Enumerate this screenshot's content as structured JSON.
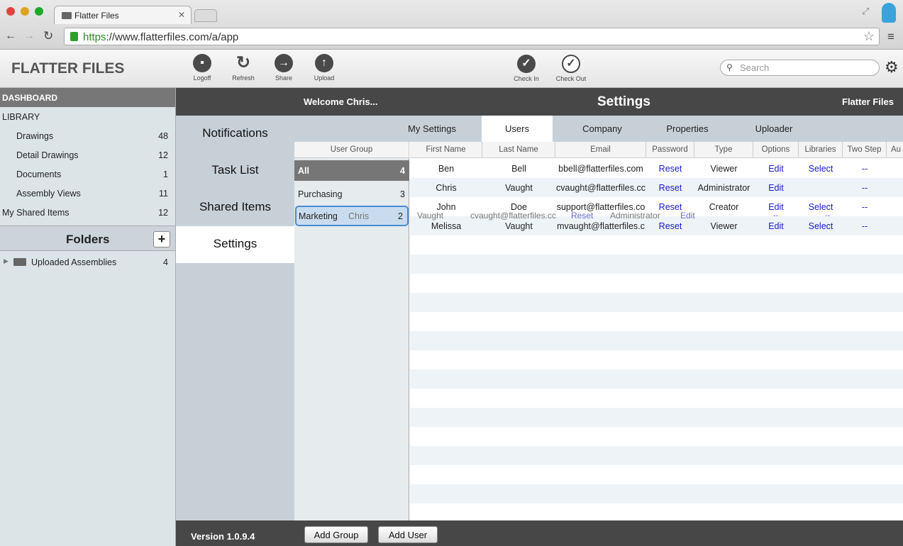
{
  "browser": {
    "tab_title": "Flatter Files",
    "url_scheme": "https",
    "url_rest": "://www.flatterfiles.com/a/app"
  },
  "app": {
    "logo": "FLATTER FILES",
    "toolbar": [
      "Logoff",
      "Refresh",
      "Share",
      "Upload",
      "Check In",
      "Check Out"
    ],
    "search_placeholder": "Search"
  },
  "sidebar": {
    "dashboard": "DASHBOARD",
    "library": "LIBRARY",
    "items": [
      {
        "label": "Drawings",
        "count": "48"
      },
      {
        "label": "Detail Drawings",
        "count": "12"
      },
      {
        "label": "Documents",
        "count": "1"
      },
      {
        "label": "Assembly Views",
        "count": "11"
      }
    ],
    "shared": {
      "label": "My Shared Items",
      "count": "12"
    },
    "folders_title": "Folders",
    "add_label": "+",
    "folder": {
      "label": "Uploaded Assemblies",
      "count": "4"
    }
  },
  "header": {
    "welcome": "Welcome Chris...",
    "title": "Settings",
    "brand": "Flatter Files"
  },
  "nav": [
    "Notifications",
    "Task List",
    "Shared Items",
    "Settings"
  ],
  "tabs": [
    "My Settings",
    "Users",
    "Company",
    "Properties",
    "Uploader"
  ],
  "groups": {
    "header": "User Group",
    "rows": [
      {
        "name": "All",
        "count": "4"
      },
      {
        "name": "Purchasing",
        "count": "3"
      },
      {
        "name": "Marketing",
        "count": "2"
      }
    ],
    "drag_ghost": "Chris"
  },
  "columns": [
    "First Name",
    "Last Name",
    "Email",
    "Password",
    "Type",
    "Options",
    "Libraries",
    "Two Step",
    "Au"
  ],
  "users": [
    {
      "first": "Ben",
      "last": "Bell",
      "email": "bbell@flatterfiles.com",
      "password": "Reset",
      "type": "Viewer",
      "options": "Edit",
      "libraries": "Select",
      "two_step": "--"
    },
    {
      "first": "Chris",
      "last": "Vaught",
      "email": "cvaught@flatterfiles.cc",
      "password": "Reset",
      "type": "Administrator",
      "options": "Edit",
      "libraries": "",
      "two_step": "--"
    },
    {
      "first": "John",
      "last": "Doe",
      "email": "support@flatterfiles.co",
      "password": "Reset",
      "type": "Creator",
      "options": "Edit",
      "libraries": "Select",
      "two_step": "--"
    },
    {
      "first": "Melissa",
      "last": "Vaught",
      "email": "mvaught@flatterfiles.c",
      "password": "Reset",
      "type": "Viewer",
      "options": "Edit",
      "libraries": "Select",
      "two_step": "--"
    }
  ],
  "drag_row": {
    "last": "Vaught",
    "email": "cvaught@flatterfiles.cc",
    "password": "Reset",
    "type": "Administrator",
    "options": "Edit",
    "libraries": "--",
    "extra": "--"
  },
  "footer": {
    "version": "Version 1.0.9.4",
    "add_group": "Add Group",
    "add_user": "Add User"
  }
}
